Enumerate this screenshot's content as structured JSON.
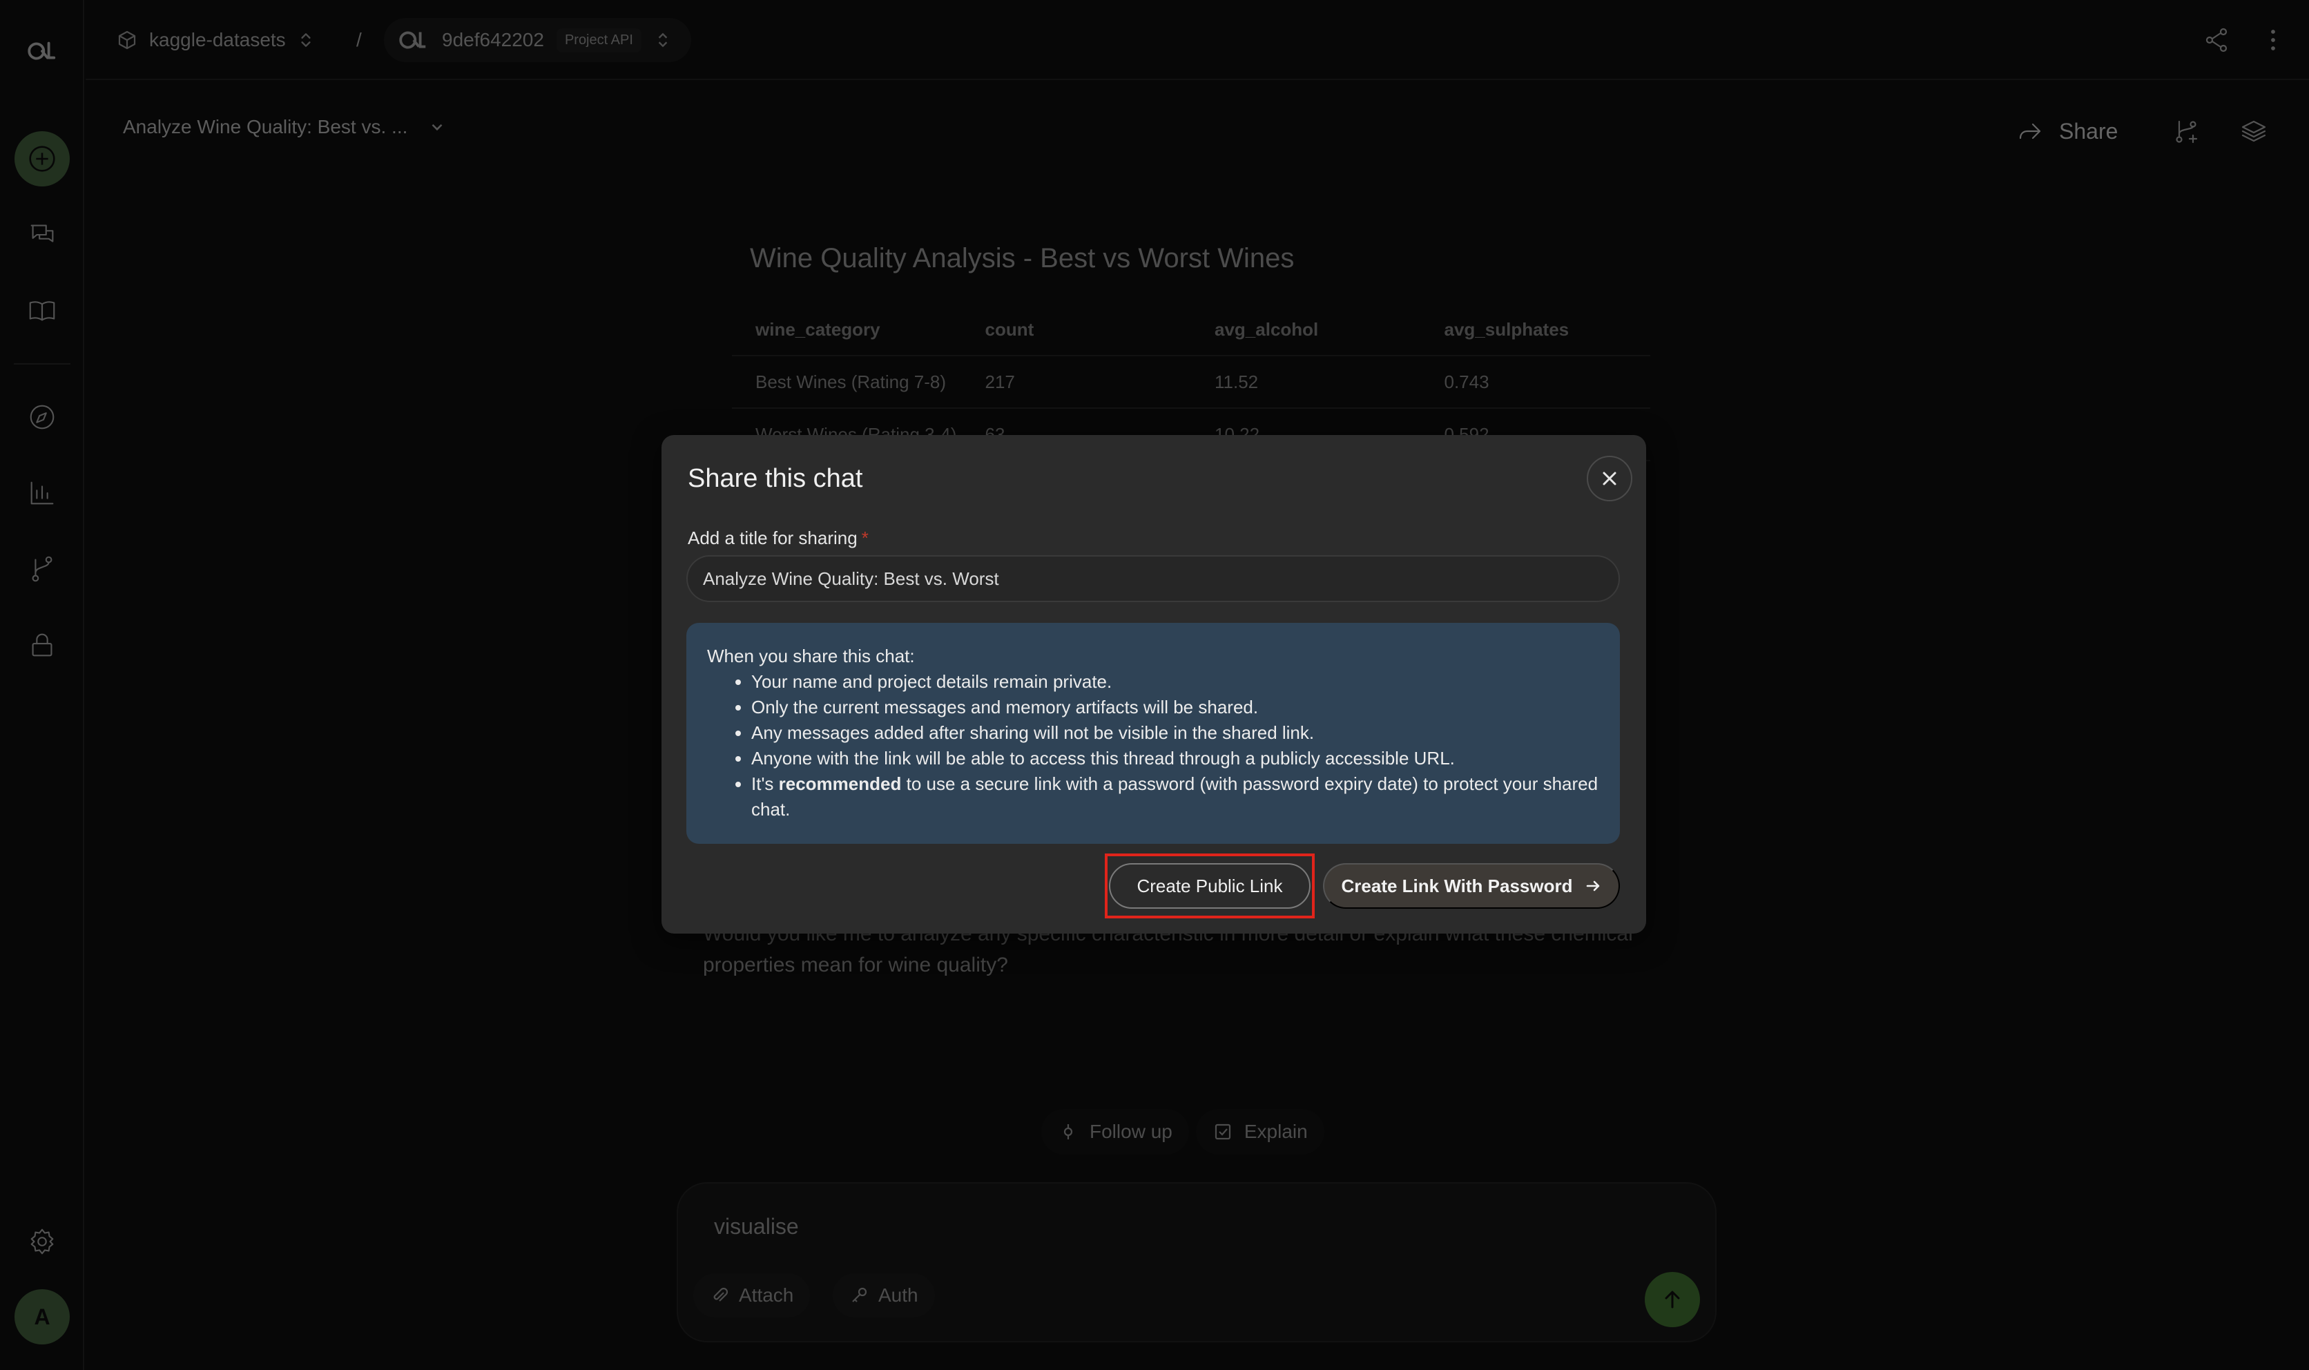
{
  "topbar": {
    "workspace": "kaggle-datasets",
    "separator": "/",
    "project_id": "9def642202",
    "project_badge": "Project API"
  },
  "subheader": {
    "chat_title": "Analyze Wine Quality: Best vs. ...",
    "share_label": "Share"
  },
  "background": {
    "table_title": "Wine Quality Analysis - Best vs Worst Wines",
    "columns": [
      "wine_category",
      "count",
      "avg_alcohol",
      "avg_sulphates"
    ],
    "rows": [
      [
        "Best Wines (Rating 7-8)",
        "217",
        "11.52",
        "0.743"
      ],
      [
        "Worst Wines (Rating 3-4)",
        "63",
        "10.22",
        "0.592"
      ]
    ],
    "followup_text": "Would you like me to analyze any specific characteristic in more detail or explain what these chemical properties mean for wine quality?"
  },
  "chips": {
    "follow_up": "Follow up",
    "explain": "Explain"
  },
  "composer": {
    "text": "visualise",
    "attach_label": "Attach",
    "auth_label": "Auth"
  },
  "sidebar": {
    "avatar_initial": "A"
  },
  "modal": {
    "title": "Share this chat",
    "field_label": "Add a title for sharing",
    "required_mark": "*",
    "title_value": "Analyze Wine Quality: Best vs. Worst",
    "info_intro": "When you share this chat:",
    "info_items": [
      "Your name and project details remain private.",
      "Only the current messages and memory artifacts will be shared.",
      "Any messages added after sharing will not be visible in the shared link.",
      "Anyone with the link will be able to access this thread through a publicly accessible URL."
    ],
    "info_last_prefix": "It's ",
    "info_last_bold": "recommended",
    "info_last_suffix": " to use a secure link with a password (with password expiry date) to protect your shared chat.",
    "create_public_label": "Create Public Link",
    "create_password_label": "Create Link With Password"
  },
  "colors": {
    "accent_green": "#3e5a3a",
    "info_box": "#2f4356",
    "highlight": "#e0241b"
  }
}
